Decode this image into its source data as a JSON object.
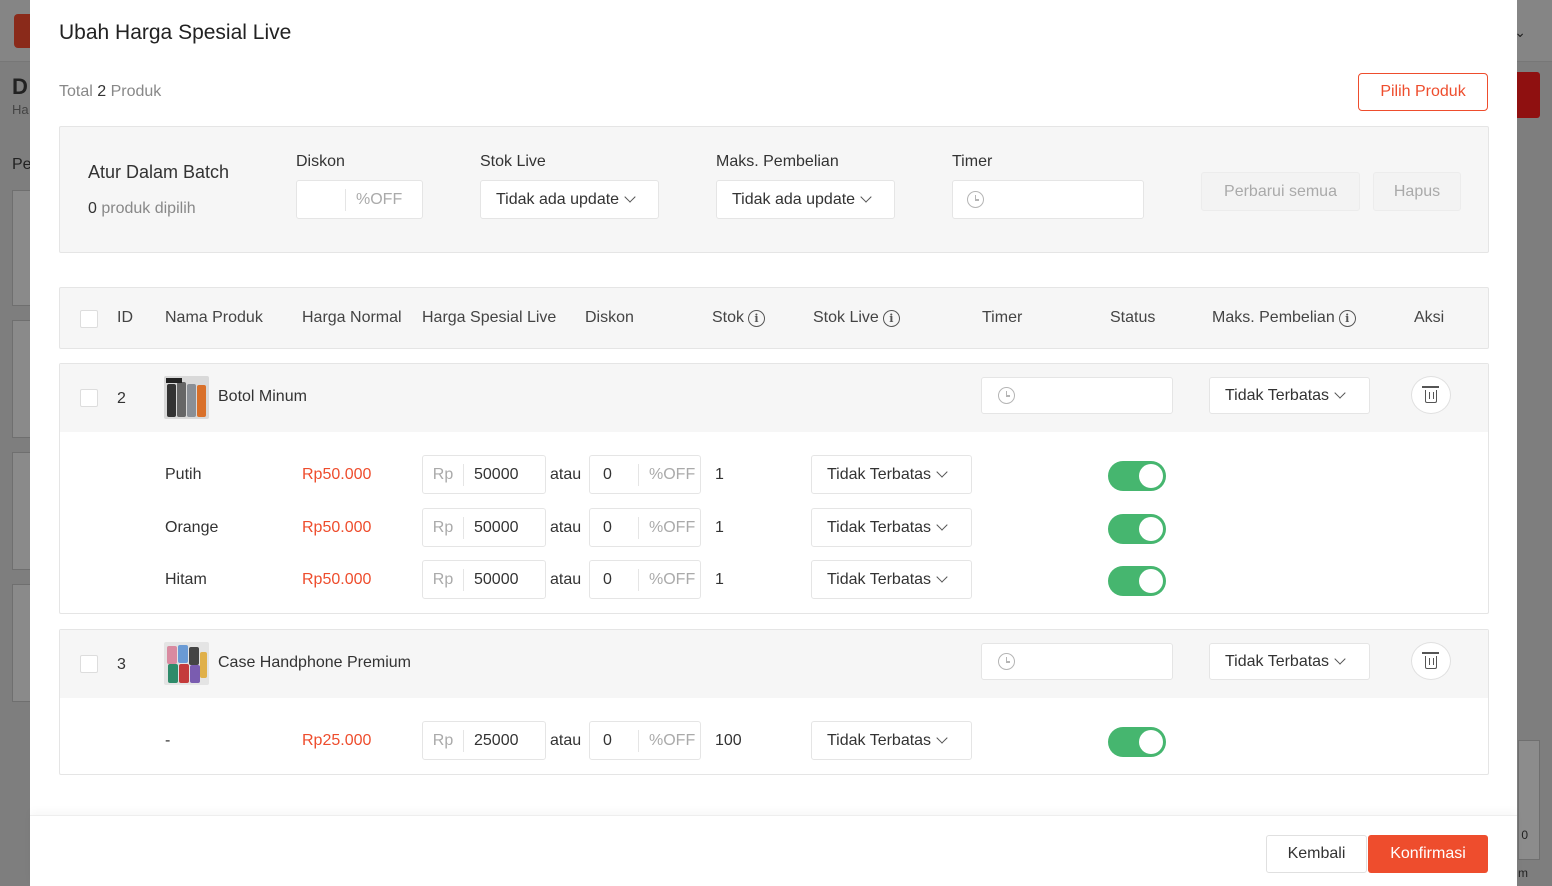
{
  "modal": {
    "title": "Ubah Harga Spesial Live",
    "total_prefix": "Total",
    "total_count": "2",
    "total_suffix": "Produk",
    "pick_product_label": "Pilih Produk"
  },
  "batch": {
    "title": "Atur Dalam Batch",
    "selected_count": "0",
    "selected_suffix": "produk dipilih",
    "discount_label": "Diskon",
    "discount_suffix": "%OFF",
    "stock_label": "Stok Live",
    "stock_value": "Tidak ada update",
    "max_label": "Maks. Pembelian",
    "max_value": "Tidak ada update",
    "timer_label": "Timer",
    "update_all_label": "Perbarui semua",
    "delete_label": "Hapus"
  },
  "table": {
    "columns": {
      "id": "ID",
      "name": "Nama Produk",
      "normal_price": "Harga Normal",
      "live_price": "Harga Spesial Live",
      "discount": "Diskon",
      "stock": "Stok",
      "stock_live": "Stok Live",
      "timer": "Timer",
      "status": "Status",
      "max_purchase": "Maks. Pembelian",
      "action": "Aksi"
    }
  },
  "products": [
    {
      "id": "2",
      "name": "Botol Minum",
      "max_purchase": "Tidak Terbatas",
      "variants": [
        {
          "name": "Putih",
          "normal_price": "Rp50.000",
          "currency": "Rp",
          "live_price": "50000",
          "or": "atau",
          "discount": "0",
          "discount_suffix": "%OFF",
          "stock": "1",
          "stock_live": "Tidak Terbatas",
          "enabled": true
        },
        {
          "name": "Orange",
          "normal_price": "Rp50.000",
          "currency": "Rp",
          "live_price": "50000",
          "or": "atau",
          "discount": "0",
          "discount_suffix": "%OFF",
          "stock": "1",
          "stock_live": "Tidak Terbatas",
          "enabled": true
        },
        {
          "name": "Hitam",
          "normal_price": "Rp50.000",
          "currency": "Rp",
          "live_price": "50000",
          "or": "atau",
          "discount": "0",
          "discount_suffix": "%OFF",
          "stock": "1",
          "stock_live": "Tidak Terbatas",
          "enabled": true
        }
      ]
    },
    {
      "id": "3",
      "name": "Case Handphone Premium",
      "max_purchase": "Tidak Terbatas",
      "variants": [
        {
          "name": "-",
          "normal_price": "Rp25.000",
          "currency": "Rp",
          "live_price": "25000",
          "or": "atau",
          "discount": "0",
          "discount_suffix": "%OFF",
          "stock": "100",
          "stock_live": "Tidak Terbatas",
          "enabled": true
        }
      ]
    }
  ],
  "footer": {
    "back_label": "Kembali",
    "confirm_label": "Konfirmasi"
  },
  "colors": {
    "accent": "#ee4d2d",
    "toggle_on": "#26aa57"
  }
}
